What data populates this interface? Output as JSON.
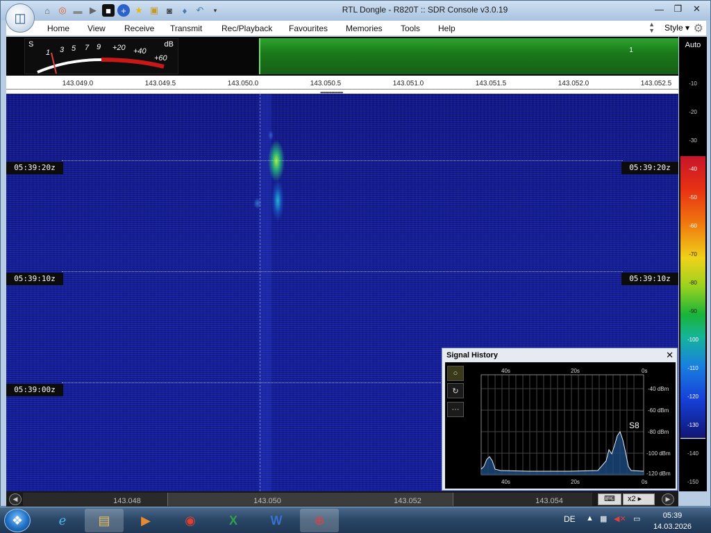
{
  "window": {
    "title": "RTL Dongle - R820T :: SDR Console v3.0.19"
  },
  "titlebar": {
    "app_orb_icon": "app-orb-icon",
    "quick_access": [
      "home-icon",
      "lifebuoy-icon",
      "folder-icon",
      "play-icon",
      "stop-icon",
      "plus-icon",
      "star-icon",
      "lock-icon",
      "camera-icon",
      "drop-icon",
      "undo-icon",
      "dropdown-icon"
    ],
    "buttons": {
      "minimize": "—",
      "restore": "❐",
      "close": "✕"
    }
  },
  "menu": {
    "items": [
      "Home",
      "View",
      "Receive",
      "Transmit",
      "Rec/Playback",
      "Favourites",
      "Memories",
      "Tools",
      "Help"
    ],
    "style_label": "Style"
  },
  "smeter": {
    "s_label": "S",
    "db_label": "dB",
    "scale": [
      "1",
      "3",
      "5",
      "7",
      "9",
      "+20",
      "+40",
      "+60"
    ]
  },
  "spectrum": {
    "vfo_label": "1",
    "freq_labels": [
      "143.049.0",
      "143.049.5",
      "143.050.0",
      "143.050.5",
      "143.051.0",
      "143.051.5",
      "143.052.0",
      "143.052.5"
    ]
  },
  "waterfall": {
    "timestamps": [
      "05:39:20z",
      "05:39:10z",
      "05:39:00z"
    ]
  },
  "colorscale": {
    "mode": "Auto",
    "ticks": [
      "-10",
      "-20",
      "-30",
      "-40",
      "-50",
      "-60",
      "-70",
      "-80",
      "-90",
      "-100",
      "-110",
      "-120",
      "-130",
      "-140",
      "-150"
    ],
    "colors": {
      "top": "#c8142a",
      "mid": "#18b43a",
      "bottom": "#101470"
    }
  },
  "signal_history": {
    "title": "Signal History",
    "close": "✕",
    "buttons": [
      "○",
      "↻",
      "···"
    ],
    "x_labels": [
      "40s",
      "20s",
      "0s"
    ],
    "y_labels": [
      "-40 dBm",
      "-60 dBm",
      "-80 dBm",
      "-100 dBm",
      "-120 dBm"
    ],
    "level": "S8"
  },
  "bottom_scroller": {
    "freqs": [
      "143.048",
      "143.050",
      "143.052",
      "143.054"
    ],
    "keyboard": "⌨",
    "zoom": "x2 ▸"
  },
  "taskbar": {
    "apps": [
      "internet-explorer-icon",
      "explorer-icon",
      "media-player-icon",
      "chrome-icon",
      "excel-icon",
      "word-icon",
      "sdr-console-icon"
    ],
    "language": "DE",
    "clock_time": "05:39",
    "clock_date": "14.03.2026"
  }
}
